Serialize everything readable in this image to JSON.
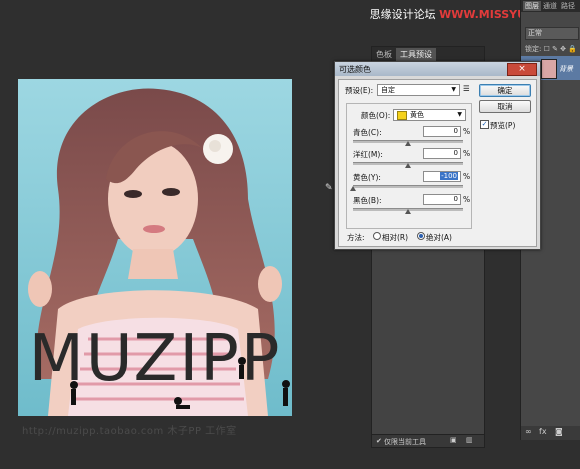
{
  "watermark": {
    "site_name": "思缘设计论坛",
    "domain": "WWW.MISSYUAN.COM"
  },
  "canvas": {
    "logo_text": "MUZIPP",
    "url_watermark": "http://muzipp.taobao.com 木子PP 工作室"
  },
  "tool_panel": {
    "tab_inactive": "色板",
    "tab_active": "工具预设",
    "footer_checkbox": "仅限当前工具"
  },
  "layers_panel": {
    "tab_layers": "图层",
    "tab_channels": "通道",
    "tab_paths": "路径",
    "blend_mode": "正常",
    "lock_label": "锁定:",
    "layer_name": "背景"
  },
  "dialog": {
    "title": "可选颜色",
    "preset_label": "预设(E):",
    "preset_value": "自定",
    "colors_label": "颜色(O):",
    "colors_value": "黄色",
    "colors_swatch": "#f5d21b",
    "ok_label": "确定",
    "cancel_label": "取消",
    "preview_label": "预览(P)",
    "preview_checked": true,
    "sliders": [
      {
        "label": "青色(C):",
        "value": "0",
        "unit": "%",
        "position": 0.5
      },
      {
        "label": "洋红(M):",
        "value": "0",
        "unit": "%",
        "position": 0.5
      },
      {
        "label": "黄色(Y):",
        "value": "-100",
        "unit": "%",
        "position": 0.0
      },
      {
        "label": "黑色(B):",
        "value": "0",
        "unit": "%",
        "position": 0.5
      }
    ],
    "method_label": "方法:",
    "method_relative": "相对(R)",
    "method_absolute": "绝对(A)",
    "method_selected": "absolute"
  }
}
